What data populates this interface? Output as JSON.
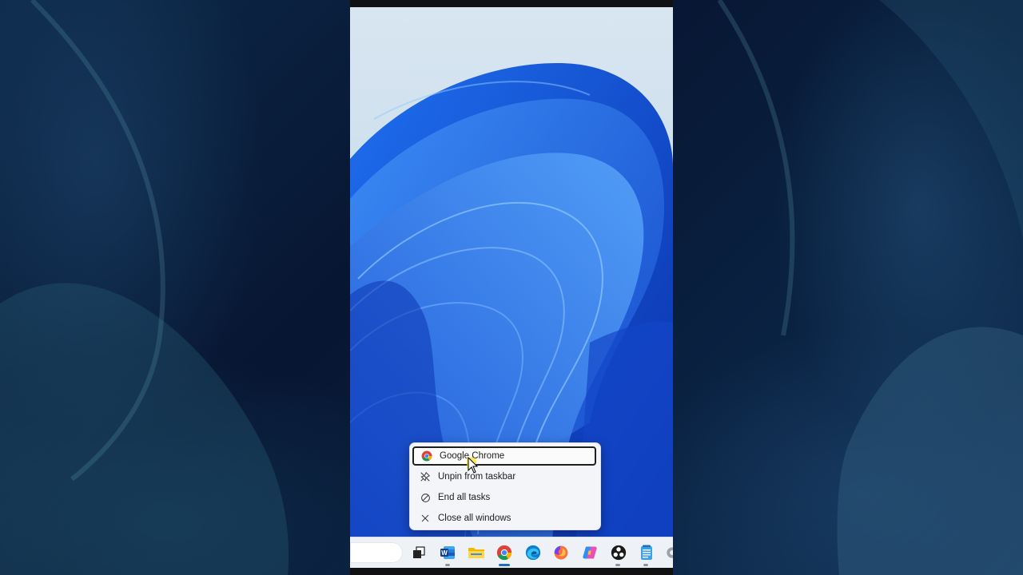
{
  "context_menu": {
    "items": [
      {
        "label": "Google Chrome",
        "icon": "chrome-icon",
        "active": true
      },
      {
        "label": "Unpin from taskbar",
        "icon": "unpin-icon",
        "active": false
      },
      {
        "label": "End all tasks",
        "icon": "end-task-icon",
        "active": false
      },
      {
        "label": "Close all windows",
        "icon": "close-icon",
        "active": false
      }
    ]
  },
  "taskbar": {
    "icons": [
      "search-box",
      "task-view-icon",
      "word-icon",
      "file-explorer-icon",
      "chrome-icon",
      "edge-icon",
      "firefox-icon",
      "copilot-icon",
      "obs-icon",
      "notepad-icon",
      "settings-icon"
    ]
  },
  "colors": {
    "accent": "#1c6fbf",
    "menu_bg": "#f3f5f8",
    "taskbar_bg": "#eef2f7"
  }
}
